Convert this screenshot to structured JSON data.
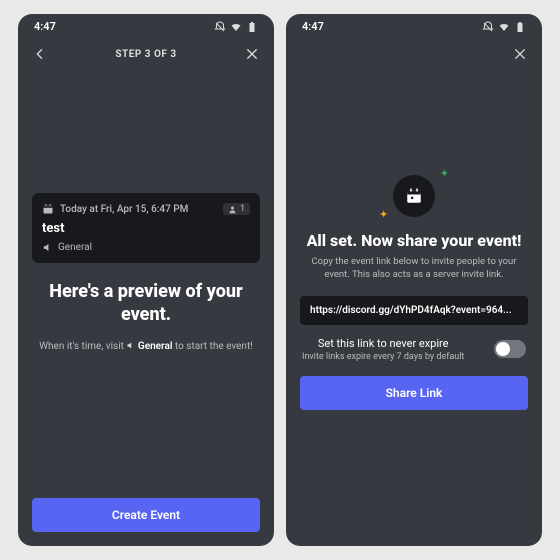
{
  "status": {
    "time": "4:47"
  },
  "left": {
    "topbar": {
      "step_label": "STEP 3 OF 3"
    },
    "event_card": {
      "date_text": "Today at Fri, Apr 15, 6:47 PM",
      "attendee_count": "1",
      "title": "test",
      "channel_name": "General"
    },
    "headline": "Here's a preview of your event.",
    "hint_prefix": "When it's time, visit ",
    "hint_channel": "General",
    "hint_suffix": " to start the event!",
    "cta_label": "Create Event"
  },
  "right": {
    "headline": "All set. Now share your event!",
    "description": "Copy the event link below to invite people to your event. This also acts as a server invite link.",
    "invite_link": "https://discord.gg/dYhPD4fAqk?event=964...",
    "toggle": {
      "title": "Set this link to never expire",
      "subtitle": "Invite links expire every 7 days by default",
      "state": "off"
    },
    "cta_label": "Share Link"
  }
}
